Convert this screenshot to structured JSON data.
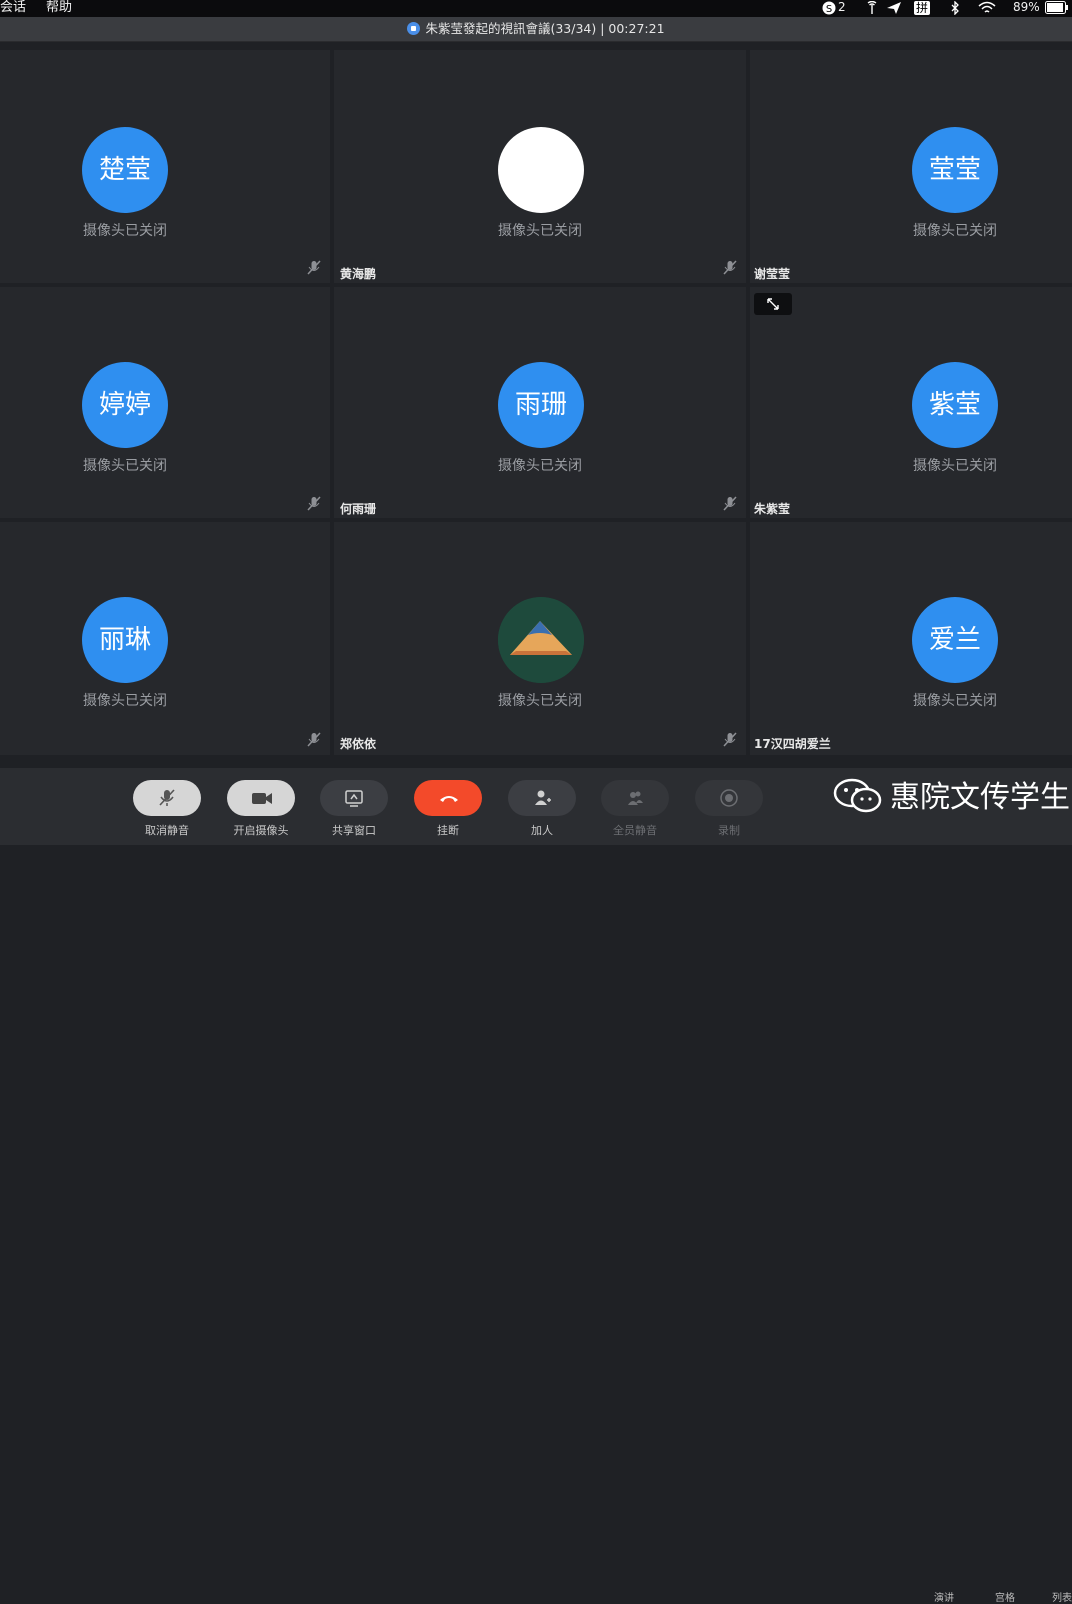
{
  "menubar": {
    "items": [
      "会话",
      "帮助"
    ],
    "notification_count": "2",
    "input_method": "拼",
    "battery": "89%"
  },
  "window": {
    "title": "朱紫莹發起的視訊會議(33/34) | 00:27:21"
  },
  "camera_off_text": "摄像头已关闭",
  "tiles": [
    {
      "avatar_text": "楚莹",
      "name": ""
    },
    {
      "avatar_text": "",
      "name": "黄海鹏"
    },
    {
      "avatar_text": "莹莹",
      "name": "谢莹莹"
    },
    {
      "avatar_text": "婷婷",
      "name": ""
    },
    {
      "avatar_text": "雨珊",
      "name": "何雨珊"
    },
    {
      "avatar_text": "紫莹",
      "name": "朱紫莹"
    },
    {
      "avatar_text": "丽琳",
      "name": ""
    },
    {
      "avatar_text": "",
      "name": "郑依依"
    },
    {
      "avatar_text": "爱兰",
      "name": "17汉四胡爱兰"
    }
  ],
  "toolbar": {
    "unmute": "取消静音",
    "start_video": "开启摄像头",
    "share_window": "共享窗口",
    "hang_up": "挂断",
    "add_people": "加人",
    "mute_all": "全员静音",
    "record": "录制",
    "presenter": "演讲",
    "grid": "宫格",
    "list": "列表"
  },
  "watermark": "惠院文传学生",
  "colors": {
    "avatar_blue": "#2f8ff0",
    "hangup_red": "#f34a2a",
    "tile_bg": "#26282c"
  },
  "icons": [
    "mic-muted-icon",
    "camera-icon",
    "share-screen-icon",
    "phone-hangup-icon",
    "add-person-icon",
    "mute-all-icon",
    "record-icon",
    "expand-icon",
    "lock-icon",
    "wechat-icon"
  ]
}
